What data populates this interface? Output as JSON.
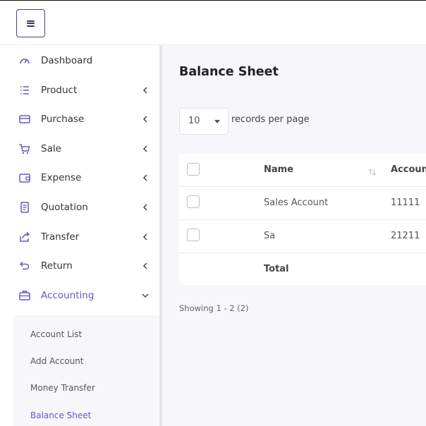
{
  "sidebar": {
    "items": [
      {
        "label": "Dashboard",
        "icon": "dashboard-gauge-icon"
      },
      {
        "label": "Product",
        "icon": "product-list-icon"
      },
      {
        "label": "Purchase",
        "icon": "purchase-card-icon"
      },
      {
        "label": "Sale",
        "icon": "sale-cart-icon"
      },
      {
        "label": "Expense",
        "icon": "expense-wallet-icon"
      },
      {
        "label": "Quotation",
        "icon": "quotation-document-icon"
      },
      {
        "label": "Transfer",
        "icon": "transfer-share-icon"
      },
      {
        "label": "Return",
        "icon": "return-arrow-icon"
      },
      {
        "label": "Accounting",
        "icon": "accounting-briefcase-icon"
      }
    ],
    "accounting_submenu": [
      "Account List",
      "Add Account",
      "Money Transfer",
      "Balance Sheet"
    ],
    "accent_color": "#6558c6"
  },
  "page": {
    "title": "Balance Sheet"
  },
  "length_menu": {
    "value": "10",
    "label": "records per page"
  },
  "table": {
    "headers": {
      "name": "Name",
      "account": "Accoun"
    },
    "rows": [
      {
        "name": "Sales Account",
        "account": "11111"
      },
      {
        "name": "Sa",
        "account": "21211"
      }
    ],
    "footer_label": "Total"
  },
  "pagination": {
    "info": "Showing 1 - 2 (2)"
  }
}
